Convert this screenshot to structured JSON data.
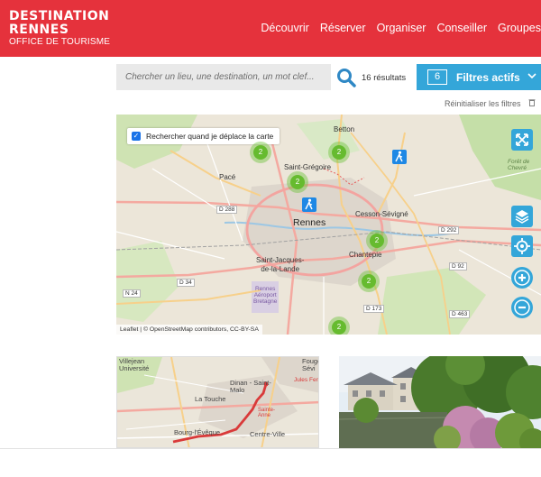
{
  "brand": {
    "line1": "DESTINATION",
    "line2": "RENNES",
    "line3": "OFFICE DE TOURISME",
    "color": "#e5323c"
  },
  "nav": {
    "items": [
      "Découvrir",
      "Réserver",
      "Organiser",
      "Conseiller",
      "Groupes"
    ]
  },
  "search": {
    "placeholder": "Chercher un lieu, une destination, un mot clef...",
    "value": "",
    "icon": "search-icon",
    "results": "16 résultats"
  },
  "filters": {
    "count": "6",
    "label": "Filtres actifs",
    "icon": "chevron-down-icon",
    "color": "#34a6d9"
  },
  "reset": {
    "label": "Réinitialiser les filtres",
    "icon": "trash-icon"
  },
  "map": {
    "checkbox_label": "Rechercher quand je déplace la carte",
    "checkbox_checked": true,
    "places": {
      "betton": "Betton",
      "pace": "Pacé",
      "saint_gregoire": "Saint-Grégoire",
      "rennes": "Rennes",
      "cesson": "Cesson-Sévigné",
      "saint_jacques": "Saint-Jacques-\nde-la-Lande",
      "chantepie": "Chantepie",
      "airport": "Rennes\nAéroport\nBretagne",
      "foret": "Forêt de\nChevré"
    },
    "roads": {
      "d288": "D 288",
      "d292": "D 292",
      "d34": "D 34",
      "n24": "N 24",
      "d173": "D 173",
      "d92": "D 92",
      "d463": "D 463"
    },
    "clusters": [
      "2",
      "2",
      "2",
      "2",
      "2",
      "2"
    ],
    "attribution": "Leaflet | © OpenStreetMap contributors, CC-BY-SA",
    "controls": [
      "fullscreen-icon",
      "layers-icon",
      "locate-icon",
      "zoom-in-icon",
      "zoom-out-icon"
    ],
    "control_color": "#34a6d9",
    "cluster_color": "#66bb2f"
  },
  "cards": {
    "map_labels": {
      "villejean": "Villejean\nUniversité",
      "dinan": "Dinan - Saint-\nMalo",
      "latouche": "La Touche",
      "bourg": "Bourg-l'Évêque",
      "centre": "Centre-Ville",
      "fougeres": "Fouge\nSévi",
      "jules": "Jules Fer",
      "sainte_anne": "Sainte-\nAnne"
    }
  }
}
